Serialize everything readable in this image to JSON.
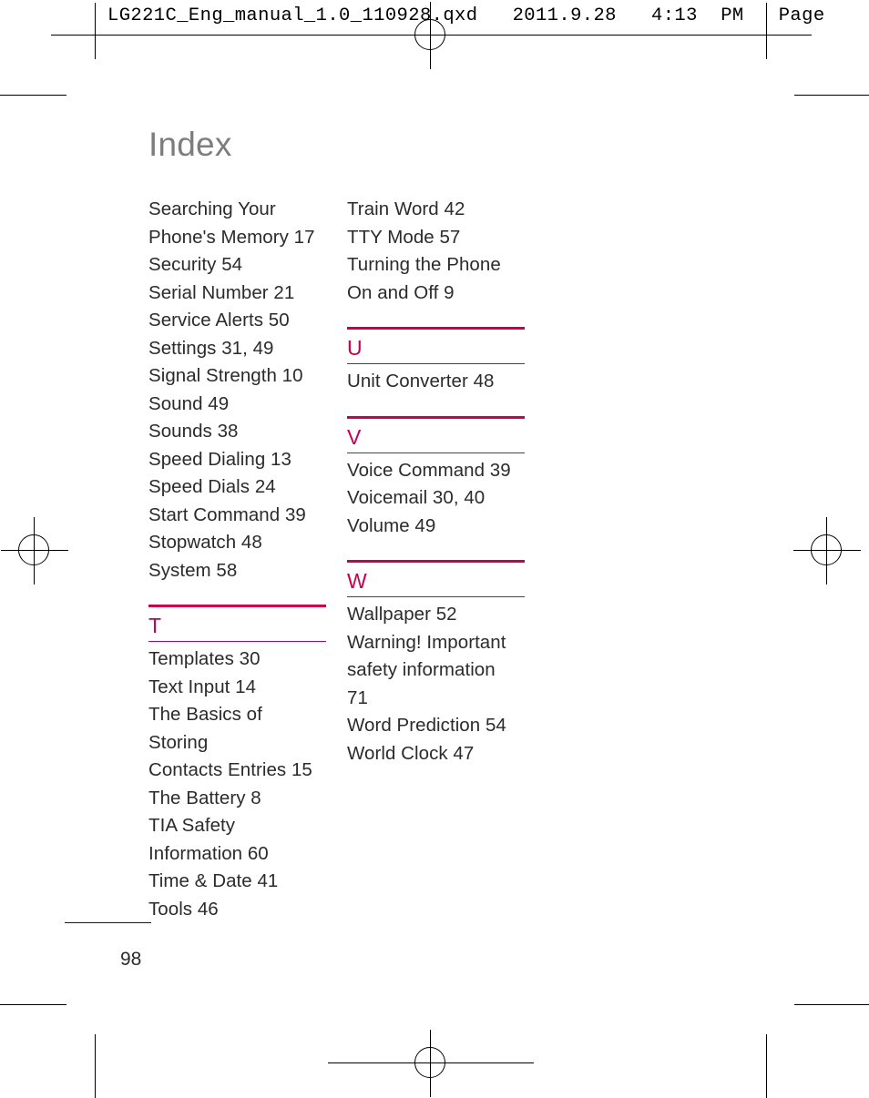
{
  "print_header": {
    "text": "LG221C_Eng_manual_1.0_110928.qxd   2011.9.28   4:13  PM   Page"
  },
  "page": {
    "title": "Index",
    "number": "98",
    "accent_color": "#c8004f",
    "title_color": "#7d7d7d",
    "text_color": "#2b2b2b"
  },
  "columns": {
    "left": [
      {
        "kind": "entry",
        "text": "Searching Your\nPhone's Memory 17"
      },
      {
        "kind": "entry",
        "text": "Security 54"
      },
      {
        "kind": "entry",
        "text": "Serial Number 21"
      },
      {
        "kind": "entry",
        "text": "Service Alerts 50"
      },
      {
        "kind": "entry",
        "text": "Settings 31, 49"
      },
      {
        "kind": "entry",
        "text": "Signal Strength 10"
      },
      {
        "kind": "entry",
        "text": "Sound 49"
      },
      {
        "kind": "entry",
        "text": "Sounds 38"
      },
      {
        "kind": "entry",
        "text": "Speed Dialing 13"
      },
      {
        "kind": "entry",
        "text": "Speed Dials 24"
      },
      {
        "kind": "entry",
        "text": "Start Command 39"
      },
      {
        "kind": "entry",
        "text": "Stopwatch 48"
      },
      {
        "kind": "entry",
        "text": "System 58"
      },
      {
        "kind": "section",
        "text": "T"
      },
      {
        "kind": "entry",
        "text": "Templates 30"
      },
      {
        "kind": "entry",
        "text": "Text Input 14"
      },
      {
        "kind": "entry",
        "text": "The Basics of Storing\nContacts Entries 15"
      },
      {
        "kind": "entry",
        "text": "The Battery 8"
      },
      {
        "kind": "entry",
        "text": "TIA Safety\nInformation 60"
      },
      {
        "kind": "entry",
        "text": "Time & Date 41"
      },
      {
        "kind": "entry",
        "text": "Tools 46"
      }
    ],
    "right": [
      {
        "kind": "entry",
        "text": "Train Word 42"
      },
      {
        "kind": "entry",
        "text": "TTY Mode 57"
      },
      {
        "kind": "entry",
        "text": "Turning the Phone\nOn and Off 9"
      },
      {
        "kind": "section",
        "text": "U"
      },
      {
        "kind": "entry",
        "text": "Unit Converter 48"
      },
      {
        "kind": "section",
        "text": "V"
      },
      {
        "kind": "entry",
        "text": "Voice Command 39"
      },
      {
        "kind": "entry",
        "text": "Voicemail 30, 40"
      },
      {
        "kind": "entry",
        "text": "Volume 49"
      },
      {
        "kind": "section",
        "text": "W"
      },
      {
        "kind": "entry",
        "text": "Wallpaper 52"
      },
      {
        "kind": "entry",
        "text": "Warning! Important\nsafety information\n71"
      },
      {
        "kind": "entry",
        "text": "Word Prediction 54"
      },
      {
        "kind": "entry",
        "text": "World Clock 47"
      }
    ]
  }
}
